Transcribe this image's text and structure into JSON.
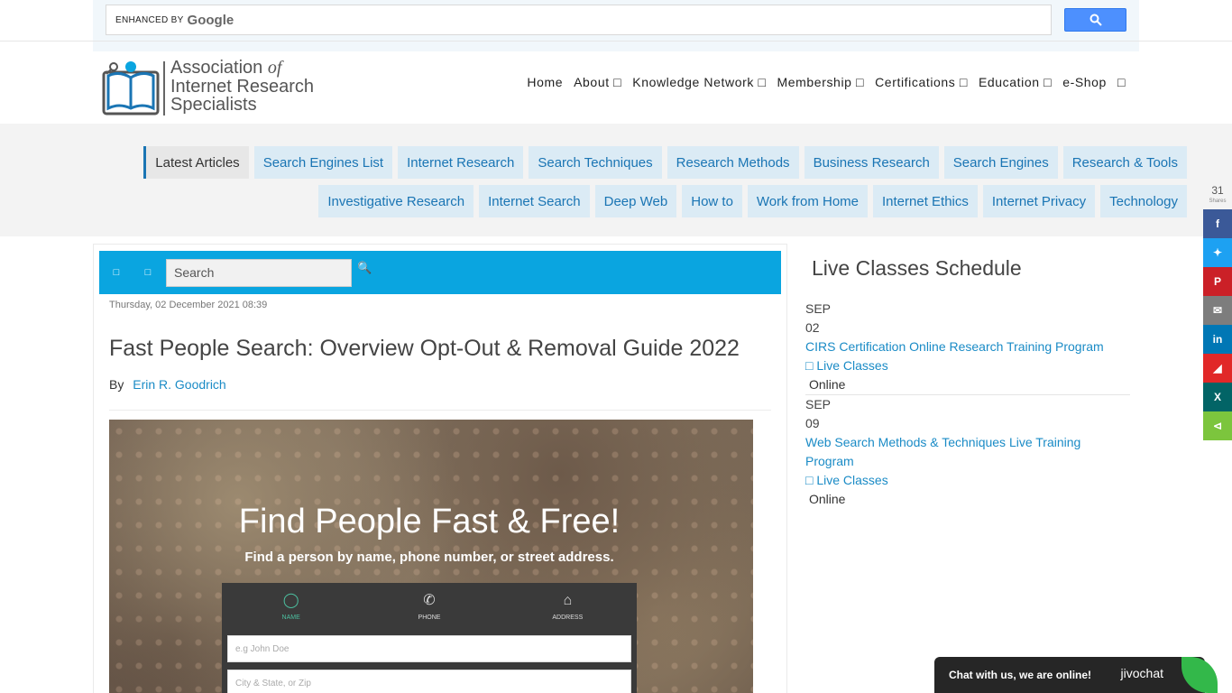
{
  "google": {
    "enhanced_by": "ENHANCED BY",
    "logo": "Google",
    "search_icon": "search-icon"
  },
  "logo": {
    "line1": "Association",
    "of": "of",
    "line2": "Internet Research",
    "line3": "Specialists"
  },
  "nav": {
    "items": [
      "Home",
      "About □",
      "Knowledge Network □",
      "Membership □",
      "Certifications □",
      "Education □",
      "e-Shop",
      "□"
    ]
  },
  "categories": [
    "Latest Articles",
    "Search Engines List",
    "Internet Research",
    "Search Techniques",
    "Research Methods",
    "Business Research",
    "Search Engines",
    "Research & Tools",
    "Investigative Research",
    "Internet Search",
    "Deep Web",
    "How to",
    "Work from Home",
    "Internet Ethics",
    "Internet Privacy",
    "Technology"
  ],
  "toolbar": {
    "icon1": "□",
    "icon2": "□",
    "search_placeholder": "Search"
  },
  "article": {
    "date": "Thursday, 02 December 2021 08:39",
    "title": "Fast People Search: Overview Opt-Out & Removal Guide 2022",
    "by": "By",
    "author": "Erin R. Goodrich",
    "hero": {
      "heading": "Find People Fast & Free!",
      "sub": "Find a person by name, phone number, or street address.",
      "tab_name": "NAME",
      "tab_phone": "PHONE",
      "tab_address": "ADDRESS",
      "ph1": "e.g John Doe",
      "ph2": "City & State, or Zip"
    }
  },
  "sidebar": {
    "title": "Live Classes Schedule",
    "events": [
      {
        "month": "SEP",
        "day": "02",
        "name": "CIRS Certification Online Research Training Program",
        "category": "□ Live Classes",
        "location": "Online"
      },
      {
        "month": "SEP",
        "day": "09",
        "name": "Web Search Methods & Techniques Live Training Program",
        "category": "□ Live Classes",
        "location": "Online"
      }
    ]
  },
  "shares": {
    "count": "31",
    "label": "Shares",
    "colors": {
      "facebook": "#3b5998",
      "twitter": "#1da1f2",
      "pinterest": "#cb2027",
      "email": "#7d7d7d",
      "linkedin": "#0077b5",
      "flipboard": "#e12828",
      "xing": "#026466",
      "share": "#7cc53d"
    }
  },
  "chat": {
    "text": "Chat with us, we are online!",
    "brand": "jivochat"
  }
}
